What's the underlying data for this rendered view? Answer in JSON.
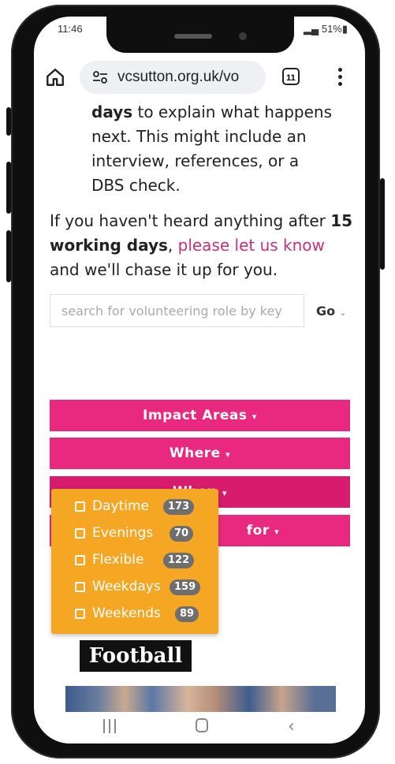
{
  "status_bar": {
    "time": "11:46",
    "battery": "51%"
  },
  "browser": {
    "url": "vcsutton.org.uk/vo",
    "tab_count": "11"
  },
  "page": {
    "paragraph1": {
      "bold": "days",
      "text": " to explain what happens next. This might include an interview, references, or a DBS check."
    },
    "paragraph2": {
      "prefix": "If you haven't heard anything after ",
      "bold": "15 working days",
      "comma": ", ",
      "link": "please let us know",
      "suffix": " and we'll chase it up for you."
    },
    "search": {
      "placeholder": "search for volunteering role by key",
      "go_label": "Go"
    },
    "filters": {
      "impact_areas": "Impact Areas",
      "where": "Where",
      "when": "When",
      "for_suffix": "for"
    },
    "when_options": [
      {
        "label": "Daytime",
        "count": "173"
      },
      {
        "label": "Evenings",
        "count": "70"
      },
      {
        "label": "Flexible",
        "count": "122"
      },
      {
        "label": "Weekdays",
        "count": "159"
      },
      {
        "label": "Weekends",
        "count": "89"
      }
    ],
    "football_logo": "Football"
  },
  "colors": {
    "filter_pink": "#e8297f",
    "dropdown_orange": "#f5a623",
    "link_pink": "#c4307a"
  }
}
